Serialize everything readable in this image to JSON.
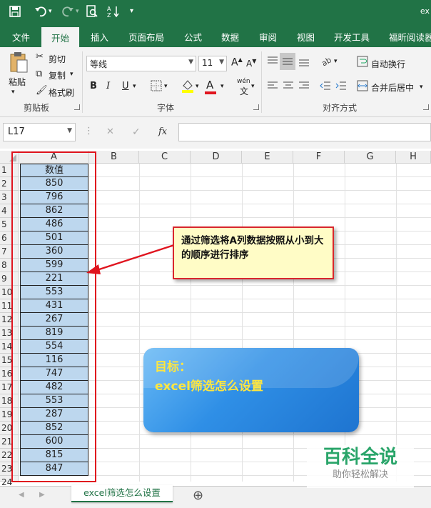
{
  "app": {
    "title_fragment": "ex",
    "accent": "#217346"
  },
  "quick_access": {
    "save_icon": "save-icon",
    "undo_icon": "undo-icon",
    "redo_icon": "redo-icon",
    "print_preview_icon": "print-preview-icon",
    "sort_icon": "sort-icon",
    "customize_icon": "customize-icon"
  },
  "tabs": [
    "文件",
    "开始",
    "插入",
    "页面布局",
    "公式",
    "数据",
    "审阅",
    "视图",
    "开发工具",
    "福昕阅读器"
  ],
  "ribbon": {
    "clipboard": {
      "paste": "粘贴",
      "cut": "剪切",
      "copy": "复制",
      "format_painter": "格式刷",
      "group_label": "剪贴板"
    },
    "font": {
      "font_name": "等线",
      "font_size": "11",
      "bold": "B",
      "italic": "I",
      "underline": "U",
      "font_color": "A",
      "phonetic": "wén",
      "group_label": "字体"
    },
    "alignment": {
      "wrap_text": "自动换行",
      "merge_center": "合并后居中",
      "group_label": "对齐方式"
    }
  },
  "formula_bar": {
    "name_box": "L17",
    "cancel": "✕",
    "enter": "✓",
    "fx": "fx",
    "formula": ""
  },
  "grid": {
    "columns": [
      "A",
      "B",
      "C",
      "D",
      "E",
      "F",
      "G",
      "H"
    ],
    "rows": [
      "1",
      "2",
      "3",
      "4",
      "5",
      "6",
      "7",
      "8",
      "9",
      "10",
      "11",
      "12",
      "13",
      "14",
      "15",
      "16",
      "17",
      "18",
      "19",
      "20",
      "21",
      "22",
      "23",
      "24"
    ],
    "header_cell": "数值",
    "values": [
      "850",
      "796",
      "862",
      "486",
      "501",
      "360",
      "599",
      "221",
      "553",
      "431",
      "267",
      "819",
      "554",
      "116",
      "747",
      "482",
      "553",
      "287",
      "852",
      "600",
      "815",
      "847"
    ]
  },
  "callout": {
    "text": "通过筛选将A列数据按照从小到大的顺序进行排序"
  },
  "goal": {
    "label": "目标：",
    "text": "excel筛选怎么设置"
  },
  "sheet": {
    "tab_name": "excel筛选怎么设置",
    "add_sheet": "⊕"
  },
  "watermark": {
    "title": "百科全说",
    "subtitle": "助你轻松解决"
  }
}
